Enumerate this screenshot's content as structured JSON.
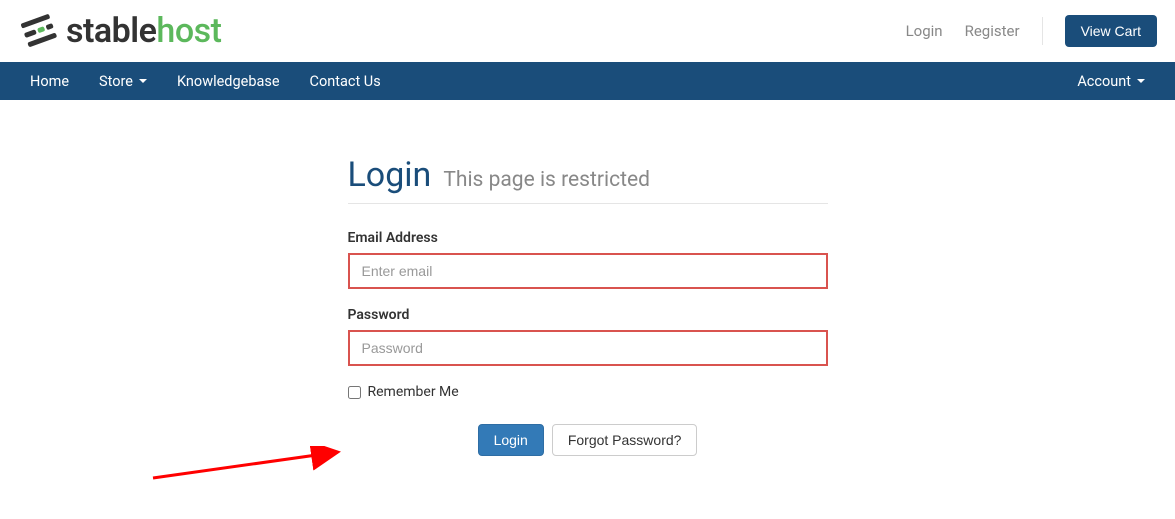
{
  "brand": {
    "stable": "stable",
    "host": "host"
  },
  "top": {
    "login": "Login",
    "register": "Register",
    "view_cart": "View Cart"
  },
  "nav": {
    "home": "Home",
    "store": "Store",
    "knowledgebase": "Knowledgebase",
    "contact": "Contact Us",
    "account": "Account"
  },
  "page": {
    "title": "Login",
    "subtitle": "This page is restricted"
  },
  "form": {
    "email_label": "Email Address",
    "email_placeholder": "Enter email",
    "password_label": "Password",
    "password_placeholder": "Password",
    "remember_label": "Remember Me",
    "login_btn": "Login",
    "forgot_btn": "Forgot Password?"
  }
}
